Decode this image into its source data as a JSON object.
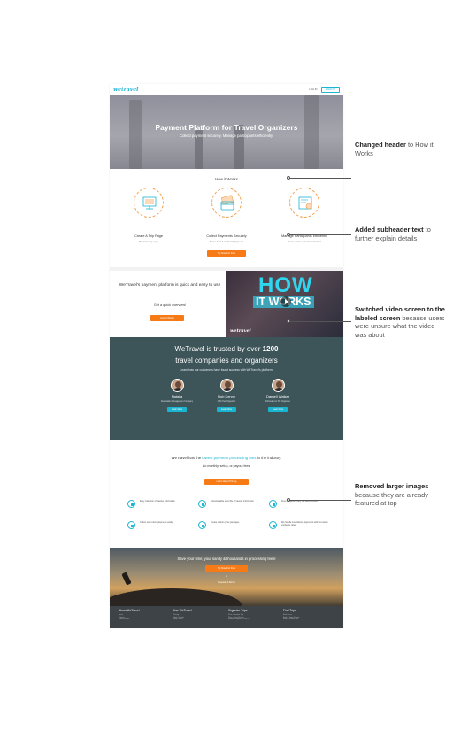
{
  "nav": {
    "logo": "wetravel",
    "login": "LOG IN",
    "signup": "SIGN UP"
  },
  "hero": {
    "title": "Payment Platform for Travel Organizers",
    "subtitle": "Collect payment securely. Manage participants efficiently."
  },
  "how_it_works": {
    "title": "How it Works",
    "steps": [
      {
        "label": "Create A Trip Page",
        "desc": "Show itinerary easily"
      },
      {
        "label": "Collect Payments Securely",
        "desc": "Secure bank & credit card payments"
      },
      {
        "label": "Manage Participants Efficiently",
        "desc": "Oversee forms and communications"
      }
    ],
    "cta": "Try Now For Free"
  },
  "video": {
    "heading": "WeTravel's payment platform is quick and easy to use",
    "sub": "Get a quick overview!",
    "cta": "How It Works",
    "screen_big": "HOW",
    "screen_small": "IT WORKS",
    "screen_logo": "wetravel"
  },
  "trust": {
    "line1": "WeTravel is trusted by over",
    "count": "1200",
    "line2": "travel companies and organizers",
    "sub": "Learn how our customers have found success with WeTravel's platform:",
    "people": [
      {
        "name": "Natalia",
        "role": "Destination Management Company",
        "cta": "Learn More"
      },
      {
        "name": "Rob Kenny",
        "role": "NBA Trek Organizer",
        "cta": "Learn More"
      },
      {
        "name": "Darnell Walker",
        "role": "Filmmaker & Trip Organizer",
        "cta": "Learn More"
      }
    ]
  },
  "fees": {
    "pre": "WeTravel has the",
    "highlight": "lowest payment processing fees",
    "post": "in the industry.",
    "sub": "No monthly, setup, or payout fees.",
    "cta": "Learn About Pricing",
    "features": [
      {
        "icon": "form-icon",
        "text": "Easy collection of traveler information"
      },
      {
        "icon": "spreadsheet-icon",
        "text": "Downloadable excel file of traveler information"
      },
      {
        "icon": "bank-icon",
        "text": "Free transfers to any US bank account"
      },
      {
        "icon": "refund-icon",
        "text": "Collect and refund payments easily"
      },
      {
        "icon": "package-icon",
        "text": "Create custom price packages"
      },
      {
        "icon": "globe-icon",
        "text": "We handle international payments with the lowest exchange rates"
      }
    ]
  },
  "sunset": {
    "title": "Save your time, your sanity & thousands in processing fees!",
    "cta": "Try Now For Free",
    "or": "or",
    "demo": "Request A Demo"
  },
  "footer": {
    "columns": [
      {
        "head": "About WeTravel",
        "links": [
          "Team",
          "Contact",
          "Travel Stories",
          "Jobs",
          "Mission",
          "Press",
          "Site Map"
        ]
      },
      {
        "head": "Use WeTravel",
        "links": [
          "Pricing",
          "How It Works",
          "Help Center",
          "FAQ for Organizers",
          "FAQ for Travelers",
          "Cancellation Policy",
          "Trust and Safety"
        ]
      },
      {
        "head": "Organize Trips",
        "links": [
          "Plan a Student Trip",
          "Plan a Yoga Retreat",
          "Booking Engine for DMC's",
          "Travel Planner Itinerary Builder",
          "Tour Operator Payment Solution",
          "Retreat Center Booking Platform",
          "Travel Company Payment System"
        ]
      },
      {
        "head": "Find Trips",
        "links": [
          "Book Tours",
          "Book a Yoga Retreat",
          "Book a Nature Tour",
          "Luxury Yoga Retreats",
          "Yoga Retreats in Costa Rica",
          "Find Affordable Yoga Retreats",
          "Costa Rica Yoga Teacher Training"
        ]
      }
    ]
  },
  "annotations": [
    {
      "bold": "Changed header",
      "rest": " to How it Works"
    },
    {
      "bold": "Added subheader text",
      "rest": " to further explain details"
    },
    {
      "bold": "Switched video screen to the labeled screen",
      "rest": " because users were unsure what the video was about"
    },
    {
      "bold": "Removed larger images",
      "rest": " because they are already featured at top"
    }
  ]
}
